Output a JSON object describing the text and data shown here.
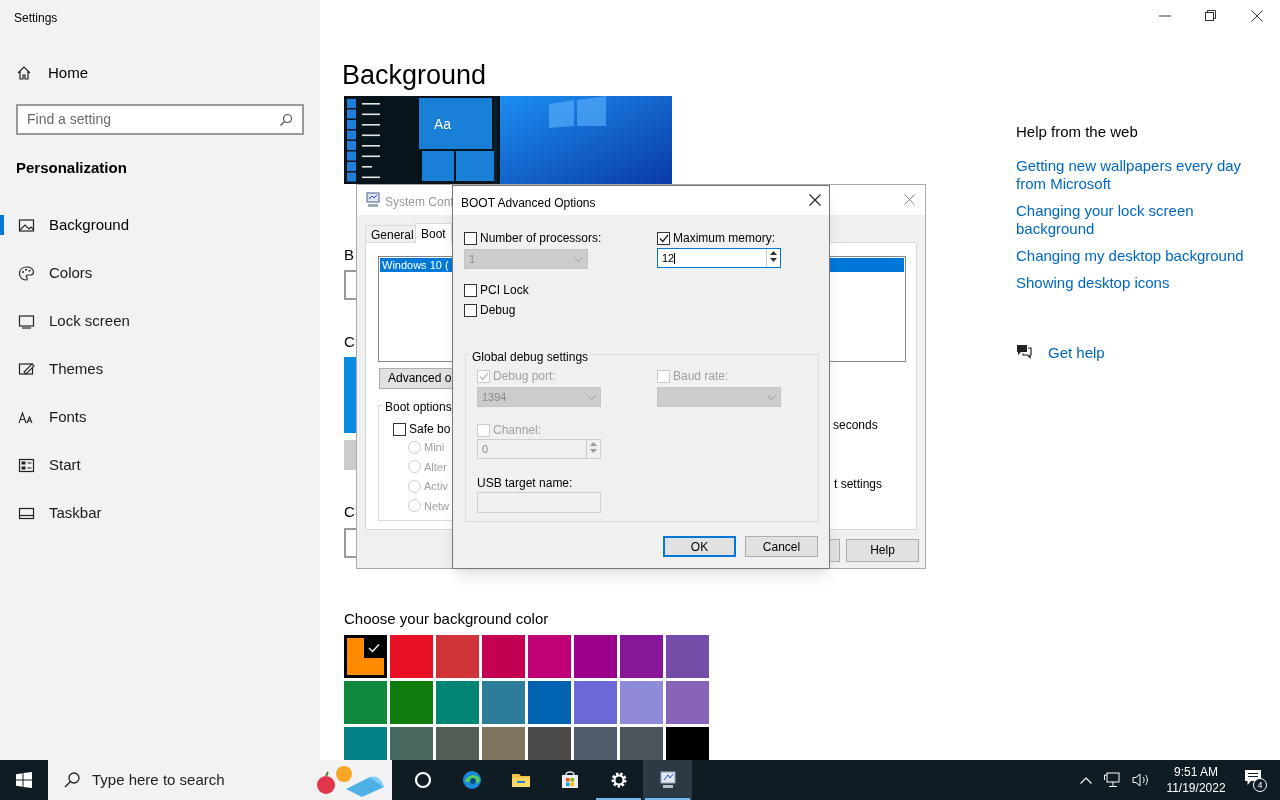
{
  "window": {
    "title": "Settings"
  },
  "sidebar": {
    "home": "Home",
    "search": {
      "placeholder": "Find a setting"
    },
    "section": "Personalization",
    "items": [
      {
        "kind": "background",
        "label": "Background",
        "selected": true
      },
      {
        "kind": "colors",
        "label": "Colors",
        "selected": false
      },
      {
        "kind": "lock",
        "label": "Lock screen",
        "selected": false
      },
      {
        "kind": "themes",
        "label": "Themes",
        "selected": false
      },
      {
        "kind": "fonts",
        "label": "Fonts",
        "selected": false
      },
      {
        "kind": "start",
        "label": "Start",
        "selected": false
      },
      {
        "kind": "taskbar",
        "label": "Taskbar",
        "selected": false
      }
    ]
  },
  "page": {
    "title": "Background",
    "preview": {
      "sample": "Aa"
    },
    "fragments": [
      "B",
      "C",
      "C"
    ],
    "color_heading": "Choose your background color",
    "colors": [
      {
        "color": "#ff8c00",
        "selected": true
      },
      {
        "color": "#e81123",
        "selected": false
      },
      {
        "color": "#d13438",
        "selected": false
      },
      {
        "color": "#c30052",
        "selected": false
      },
      {
        "color": "#bf0077",
        "selected": false
      },
      {
        "color": "#9a0089",
        "selected": false
      },
      {
        "color": "#881798",
        "selected": false
      },
      {
        "color": "#744da9",
        "selected": false
      },
      {
        "color": "#10893e",
        "selected": false
      },
      {
        "color": "#107c10",
        "selected": false
      },
      {
        "color": "#018574",
        "selected": false
      },
      {
        "color": "#2d7d9a",
        "selected": false
      },
      {
        "color": "#0063b1",
        "selected": false
      },
      {
        "color": "#6b69d6",
        "selected": false
      },
      {
        "color": "#8e8cd8",
        "selected": false
      },
      {
        "color": "#8764b8",
        "selected": false
      },
      {
        "color": "#038387",
        "selected": false
      },
      {
        "color": "#486860",
        "selected": false
      },
      {
        "color": "#525e54",
        "selected": false
      },
      {
        "color": "#7e735f",
        "selected": false
      },
      {
        "color": "#4c4a48",
        "selected": false
      },
      {
        "color": "#515c6b",
        "selected": false
      },
      {
        "color": "#4a5459",
        "selected": false
      },
      {
        "color": "#000000",
        "selected": false
      }
    ]
  },
  "help": {
    "title": "Help from the web",
    "links": [
      "Getting new wallpapers every day from Microsoft",
      "Changing your lock screen background",
      "Changing my desktop background",
      "Showing desktop icons"
    ],
    "get_help": "Get help"
  },
  "system_config": {
    "title": "System Conf",
    "tabs": [
      {
        "label": "General",
        "selected": false
      },
      {
        "label": "Boot",
        "selected": true
      }
    ],
    "os_entry": {
      "label": "Windows 10 (",
      "selected": true
    },
    "advanced_button": "Advanced o",
    "boot_options": {
      "title": "Boot options",
      "safe_boot": {
        "label": "Safe bo",
        "checked": false
      },
      "modes": [
        {
          "label": "Mini",
          "selected": false,
          "disabled": true
        },
        {
          "label": "Alter",
          "selected": false,
          "disabled": true
        },
        {
          "label": "Activ",
          "selected": false,
          "disabled": true
        },
        {
          "label": "Netw",
          "selected": false,
          "disabled": true
        }
      ]
    },
    "timeout_unit": "seconds",
    "permanent_label": "t settings",
    "help_button": "Help"
  },
  "boot_advanced": {
    "title": "BOOT Advanced Options",
    "processors": {
      "label": "Number of processors:",
      "checked": false,
      "value": "1"
    },
    "max_memory": {
      "label": "Maximum memory:",
      "checked": true,
      "value": "12"
    },
    "pci_lock": {
      "label": "PCI Lock",
      "checked": false
    },
    "debug": {
      "label": "Debug",
      "checked": false
    },
    "debug_settings": {
      "title": "Global debug settings",
      "debug_port": {
        "label": "Debug port:",
        "checked": true,
        "value": "1394"
      },
      "baud_rate": {
        "label": "Baud rate:",
        "checked": false
      },
      "channel": {
        "label": "Channel:",
        "checked": false,
        "value": "0"
      },
      "usb_target": {
        "label": "USB target name:"
      }
    },
    "buttons": [
      {
        "label": "OK",
        "default": true
      },
      {
        "label": "Cancel",
        "default": false
      }
    ]
  },
  "taskbar": {
    "search": {
      "placeholder": "Type here to search"
    },
    "apps": [
      {
        "kind": "cortana",
        "open": false,
        "selected": false
      },
      {
        "kind": "edge",
        "open": false,
        "selected": false
      },
      {
        "kind": "explorer",
        "open": false,
        "selected": false
      },
      {
        "kind": "store",
        "open": false,
        "selected": false
      },
      {
        "kind": "settings",
        "open": true,
        "selected": false
      },
      {
        "kind": "sysconfig",
        "open": true,
        "selected": true
      }
    ],
    "time": "9:51 AM",
    "date": "11/19/2022",
    "notifications": "4"
  }
}
